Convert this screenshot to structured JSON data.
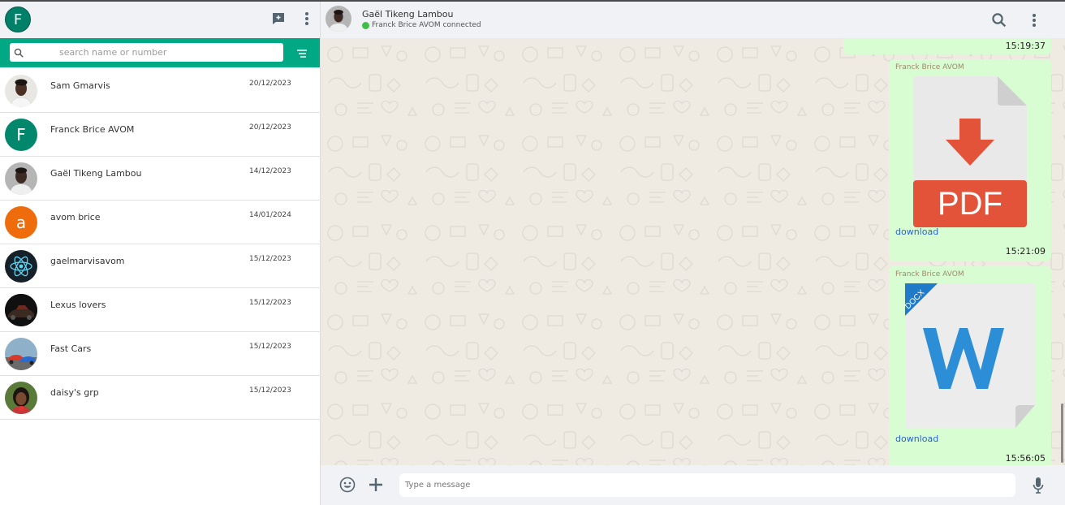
{
  "sidebar": {
    "profile_initial": "F",
    "search_placeholder": "search name or number",
    "chats": [
      {
        "name": "Sam Gmarvis",
        "date": "20/12/2023",
        "avatar": "photo-sam"
      },
      {
        "name": "Franck Brice AVOM",
        "date": "20/12/2023",
        "avatar": "initial",
        "initial": "F",
        "color": "#00876c"
      },
      {
        "name": "Gaël Tikeng Lambou",
        "date": "14/12/2023",
        "avatar": "photo-gael"
      },
      {
        "name": "avom brice",
        "date": "14/01/2024",
        "avatar": "initial",
        "initial": "a",
        "color": "#ee6c0c"
      },
      {
        "name": "gaelmarvisavom",
        "date": "15/12/2023",
        "avatar": "react-logo"
      },
      {
        "name": "Lexus lovers",
        "date": "15/12/2023",
        "avatar": "photo-lexus"
      },
      {
        "name": "Fast Cars",
        "date": "15/12/2023",
        "avatar": "photo-cars"
      },
      {
        "name": "daisy's grp",
        "date": "15/12/2023",
        "avatar": "photo-daisy"
      }
    ]
  },
  "conversation": {
    "contact_name": "Gaël Tikeng Lambou",
    "status": "Franck Brice AVOM connected",
    "messages": [
      {
        "time": "15:19:37"
      },
      {
        "sender": "Franck Brice AVOM",
        "file_type": "PDF",
        "link": "download",
        "time": "15:21:09"
      },
      {
        "sender": "Franck Brice AVOM",
        "file_type": "DOCX",
        "link": "download",
        "time": "15:56:05"
      }
    ],
    "pdf_label": "PDF",
    "docx_label": "DOCX",
    "input_placeholder": "Type a message"
  },
  "colors": {
    "accent": "#00a884",
    "bubble_out": "#d9fdd3",
    "header_bg": "#f0f2f5",
    "link": "#2a63c9"
  }
}
